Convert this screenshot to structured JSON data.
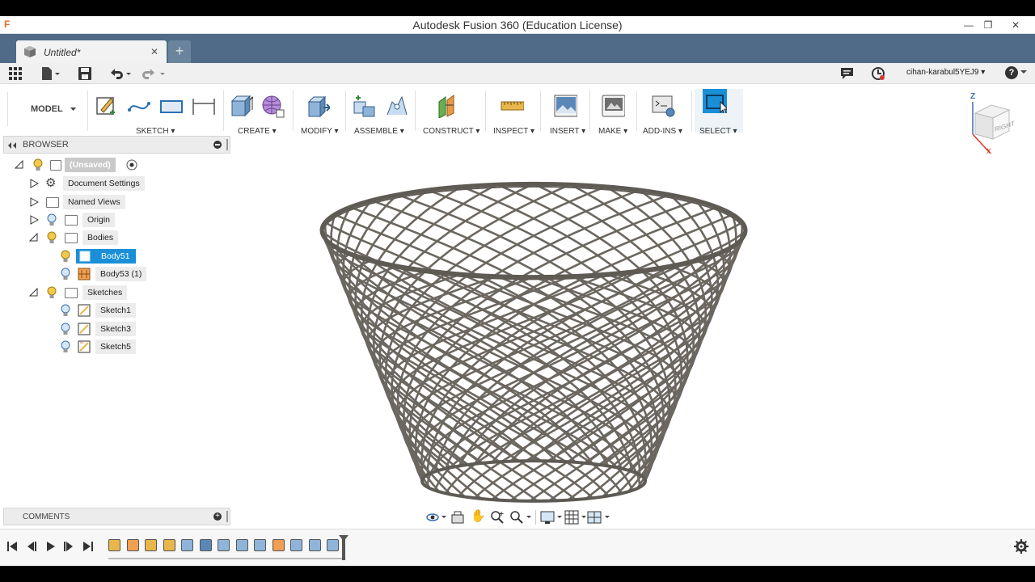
{
  "window": {
    "title": "Autodesk Fusion 360 (Education License)",
    "logo_glyph": "F",
    "minimize_glyph": "—",
    "restore_glyph": "❐",
    "close_glyph": "✕"
  },
  "tabs": [
    {
      "label": "Untitled*",
      "close_glyph": "✕"
    }
  ],
  "new_tab_glyph": "+",
  "quick_access": {
    "user": "cihan-karabul5YEJ9 ▾",
    "help_glyph": "?"
  },
  "ribbon": {
    "workspace": "MODEL",
    "groups": [
      {
        "label": "SKETCH ▾"
      },
      {
        "label": "CREATE ▾"
      },
      {
        "label": "MODIFY ▾"
      },
      {
        "label": "ASSEMBLE ▾"
      },
      {
        "label": "CONSTRUCT ▾"
      },
      {
        "label": "INSPECT ▾"
      },
      {
        "label": "INSERT ▾"
      },
      {
        "label": "MAKE ▾"
      },
      {
        "label": "ADD-INS ▾"
      },
      {
        "label": "SELECT ▾"
      }
    ]
  },
  "browser": {
    "title": "BROWSER",
    "root": "(Unsaved)",
    "nodes": {
      "document_settings": "Document Settings",
      "named_views": "Named Views",
      "origin": "Origin",
      "bodies": "Bodies",
      "body51": "Body51",
      "body53": "Body53 (1)",
      "sketches": "Sketches",
      "sketch1": "Sketch1",
      "sketch3": "Sketch3",
      "sketch5": "Sketch5"
    }
  },
  "comments": {
    "title": "COMMENTS"
  },
  "viewcube": {
    "face": "RIGHT",
    "axis_z": "Z",
    "axis_x": "X"
  },
  "colors": {
    "accent": "#1a8fd8",
    "tab_strip": "#4f6b87",
    "mesh": "#6b6760"
  }
}
